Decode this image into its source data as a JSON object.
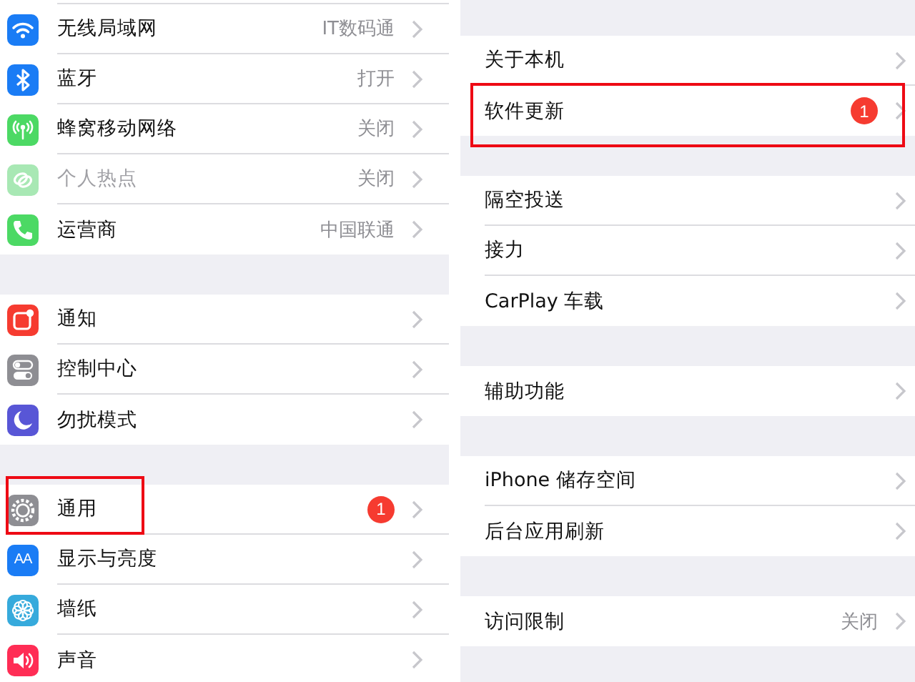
{
  "left_panel": {
    "groups": [
      {
        "items": [
          {
            "kind": "wifi",
            "color": "#1a7cf5",
            "label": "无线局域网",
            "value": "IT数码通",
            "disabled": false,
            "highlighted": false
          },
          {
            "kind": "bluetooth",
            "color": "#1a7cf5",
            "label": "蓝牙",
            "value": "打开",
            "disabled": false,
            "highlighted": false
          },
          {
            "kind": "cellular",
            "color": "#4cd964",
            "label": "蜂窝移动网络",
            "value": "关闭",
            "disabled": false,
            "highlighted": false
          },
          {
            "kind": "hotspot",
            "color": "#a8e8b4",
            "label": "个人热点",
            "value": "关闭",
            "disabled": true,
            "highlighted": false
          },
          {
            "kind": "phone",
            "color": "#4cd964",
            "label": "运营商",
            "value": "中国联通",
            "disabled": false,
            "highlighted": false
          }
        ]
      },
      {
        "items": [
          {
            "kind": "notification",
            "color": "#f63b30",
            "label": "通知",
            "disabled": false,
            "highlighted": false
          },
          {
            "kind": "toggles",
            "color": "#8e8e93",
            "label": "控制中心",
            "disabled": false,
            "highlighted": false
          },
          {
            "kind": "moon",
            "color": "#5856d6",
            "label": "勿扰模式",
            "disabled": false,
            "highlighted": false
          }
        ]
      },
      {
        "items": [
          {
            "kind": "gear",
            "color": "#8e8e93",
            "label": "通用",
            "badge": "1",
            "disabled": false,
            "highlighted": true
          },
          {
            "kind": "text",
            "icon_text": "AA",
            "color": "#1a7cf5",
            "label": "显示与亮度",
            "disabled": false,
            "highlighted": false
          },
          {
            "kind": "flower",
            "color": "#36aadc",
            "label": "墙纸",
            "disabled": false,
            "highlighted": false
          },
          {
            "kind": "speaker",
            "color": "#ff2d55",
            "label": "声音",
            "disabled": false,
            "highlighted": false
          }
        ]
      }
    ]
  },
  "right_panel": {
    "groups": [
      {
        "items": [
          {
            "label": "关于本机",
            "highlighted": false
          },
          {
            "label": "软件更新",
            "badge": "1",
            "highlighted": true
          }
        ]
      },
      {
        "items": [
          {
            "label": "隔空投送",
            "highlighted": false
          },
          {
            "label": "接力",
            "highlighted": false
          },
          {
            "label": "CarPlay 车载",
            "highlighted": false
          }
        ]
      },
      {
        "items": [
          {
            "label": "辅助功能",
            "highlighted": false
          }
        ]
      },
      {
        "items": [
          {
            "label": "iPhone 储存空间",
            "highlighted": false
          },
          {
            "label": "后台应用刷新",
            "highlighted": false
          }
        ]
      },
      {
        "items": [
          {
            "label": "访问限制",
            "value": "关闭",
            "highlighted": false
          }
        ]
      }
    ]
  }
}
